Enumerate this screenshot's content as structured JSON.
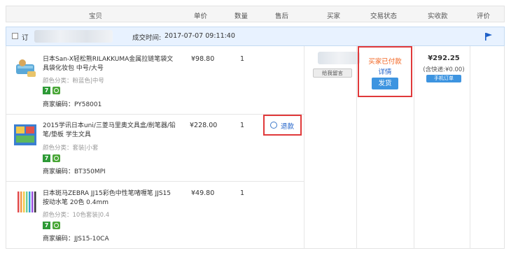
{
  "header": {
    "product": "宝贝",
    "unit_price": "单价",
    "quantity": "数量",
    "after_sale": "售后",
    "buyer": "买家",
    "trade_status": "交易状态",
    "amount_paid": "实收款",
    "review": "评价"
  },
  "order": {
    "prefix": "订",
    "time_label": "成交时间:",
    "time_value": "2017-07-07 09:11:40"
  },
  "items": [
    {
      "title": "日本San-X轻松熊RILAKKUMA金属拉链笔袋文具袋化妆包 中号/大号",
      "variant": "颜色分类：粉蓝色|中号",
      "code": "商家编码：PY58001",
      "price": "¥98.80",
      "qty": "1",
      "badge": "7"
    },
    {
      "title": "2015学讯日本uni/三菱马里奥文具盒/削笔器/铅笔/垫板 学生文具",
      "variant": "颜色分类：套装|小套",
      "code": "商家编码：BT350MPI",
      "price": "¥228.00",
      "qty": "1",
      "badge": "7",
      "refund": "退款"
    },
    {
      "title": "日本斑马ZEBRA JJ15彩色中性笔啫喱笔 JJS15按动水笔 20色 0.4mm",
      "variant": "颜色分类：10色套装|0.4",
      "code": "商家编码：JJS15-10CA",
      "price": "¥49.80",
      "qty": "1",
      "badge": "7"
    }
  ],
  "buyer": {
    "message_button": "给我留言"
  },
  "status": {
    "paid": "买家已付款",
    "detail": "详情",
    "ship_button": "发货"
  },
  "payment": {
    "total": "¥292.25",
    "shipping": "(含快递:¥0.00)",
    "mobile_order": "手机订单"
  },
  "colors": {
    "accent_blue": "#3d94e0",
    "highlight_red": "#e0393a",
    "status_orange": "#f26522",
    "link_blue": "#1a5dc7",
    "badge_green": "#2d9a36"
  }
}
